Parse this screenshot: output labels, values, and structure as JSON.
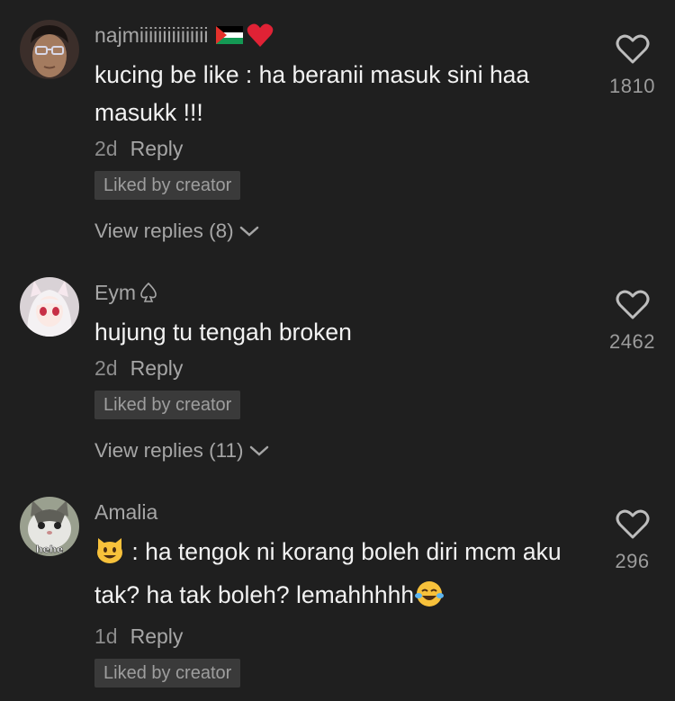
{
  "comments": [
    {
      "username": "najmiiiiiiiiiiiiiii",
      "username_emojis": [
        "palestine-flag-icon",
        "red-heart-icon"
      ],
      "text": "kucing be like : ha beranii masuk sini haa masukk !!!",
      "time": "2d",
      "reply_label": "Reply",
      "badge": "Liked by creator",
      "view_replies": "View replies (8)",
      "likes": "1810"
    },
    {
      "username": "Eym",
      "username_emojis": [
        "spade-outline-icon"
      ],
      "text": "hujung tu tengah broken",
      "time": "2d",
      "reply_label": "Reply",
      "badge": "Liked by creator",
      "view_replies": "View replies (11)",
      "likes": "2462"
    },
    {
      "username": "Amalia",
      "username_emojis": [],
      "text_prefix_emoji": "grinning-cat-icon",
      "text": ": ha tengok ni korang boleh diri mcm aku tak? ha tak boleh? lemahhhhh",
      "text_suffix_emoji": "tears-of-joy-icon",
      "avatar_label": "hehe",
      "time": "1d",
      "reply_label": "Reply",
      "badge": "Liked by creator",
      "likes": "296"
    }
  ],
  "colors": {
    "background": "#1f1f1f",
    "username": "#a6a6a6",
    "text": "#f2f2f2",
    "badge_bg": "#3a3a3a"
  }
}
